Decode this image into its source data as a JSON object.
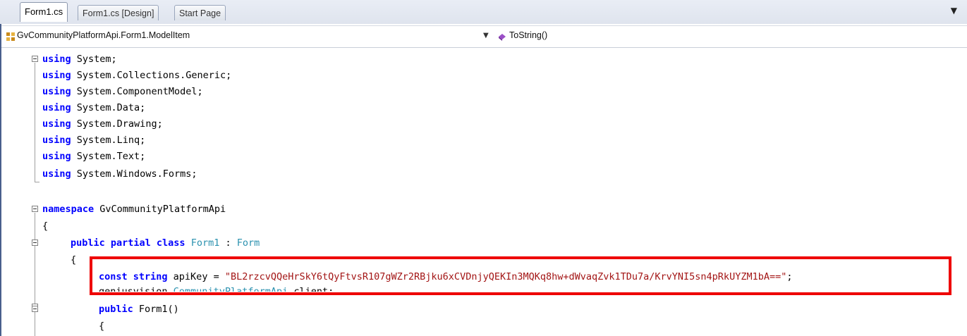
{
  "tabs": [
    {
      "label": "Form1.cs",
      "active": true
    },
    {
      "label": "Form1.cs [Design]",
      "active": false
    },
    {
      "label": "Start Page",
      "active": false
    }
  ],
  "tab_menu_glyph": "▼",
  "navbar": {
    "type_selector": "GvCommunityPlatformApi.Form1.ModelItem",
    "member_selector": "ToString()",
    "dropdown_glyph": "▼"
  },
  "code": {
    "using_kw": "using",
    "usings": [
      "System;",
      "System.Collections.Generic;",
      "System.ComponentModel;",
      "System.Data;",
      "System.Drawing;",
      "System.Linq;",
      "System.Text;",
      "System.Windows.Forms;"
    ],
    "namespace_kw": "namespace",
    "namespace_name": "GvCommunityPlatformApi",
    "open_brace": "{",
    "class_modifiers": "public partial class",
    "class_name": "Form1",
    "class_colon": " : ",
    "class_base": "Form",
    "const_kw": "const string",
    "field_name": " apiKey = ",
    "api_key_value": "\"BL2rzcvQQeHrSkY6tQyFtvsR107gWZr2RBjku6xCVDnjyQEKIn3MQKq8hw+dWvaqZvk1TDu7a/KrvYNI5sn4pRkUYZM1bA==\"",
    "semicolon": ";",
    "client_prefix": "geniusvision.",
    "client_type": "CommunityPlatformApi",
    "client_suffix": " client;",
    "ctor_modifier": "public",
    "ctor_name": " Form1()"
  }
}
